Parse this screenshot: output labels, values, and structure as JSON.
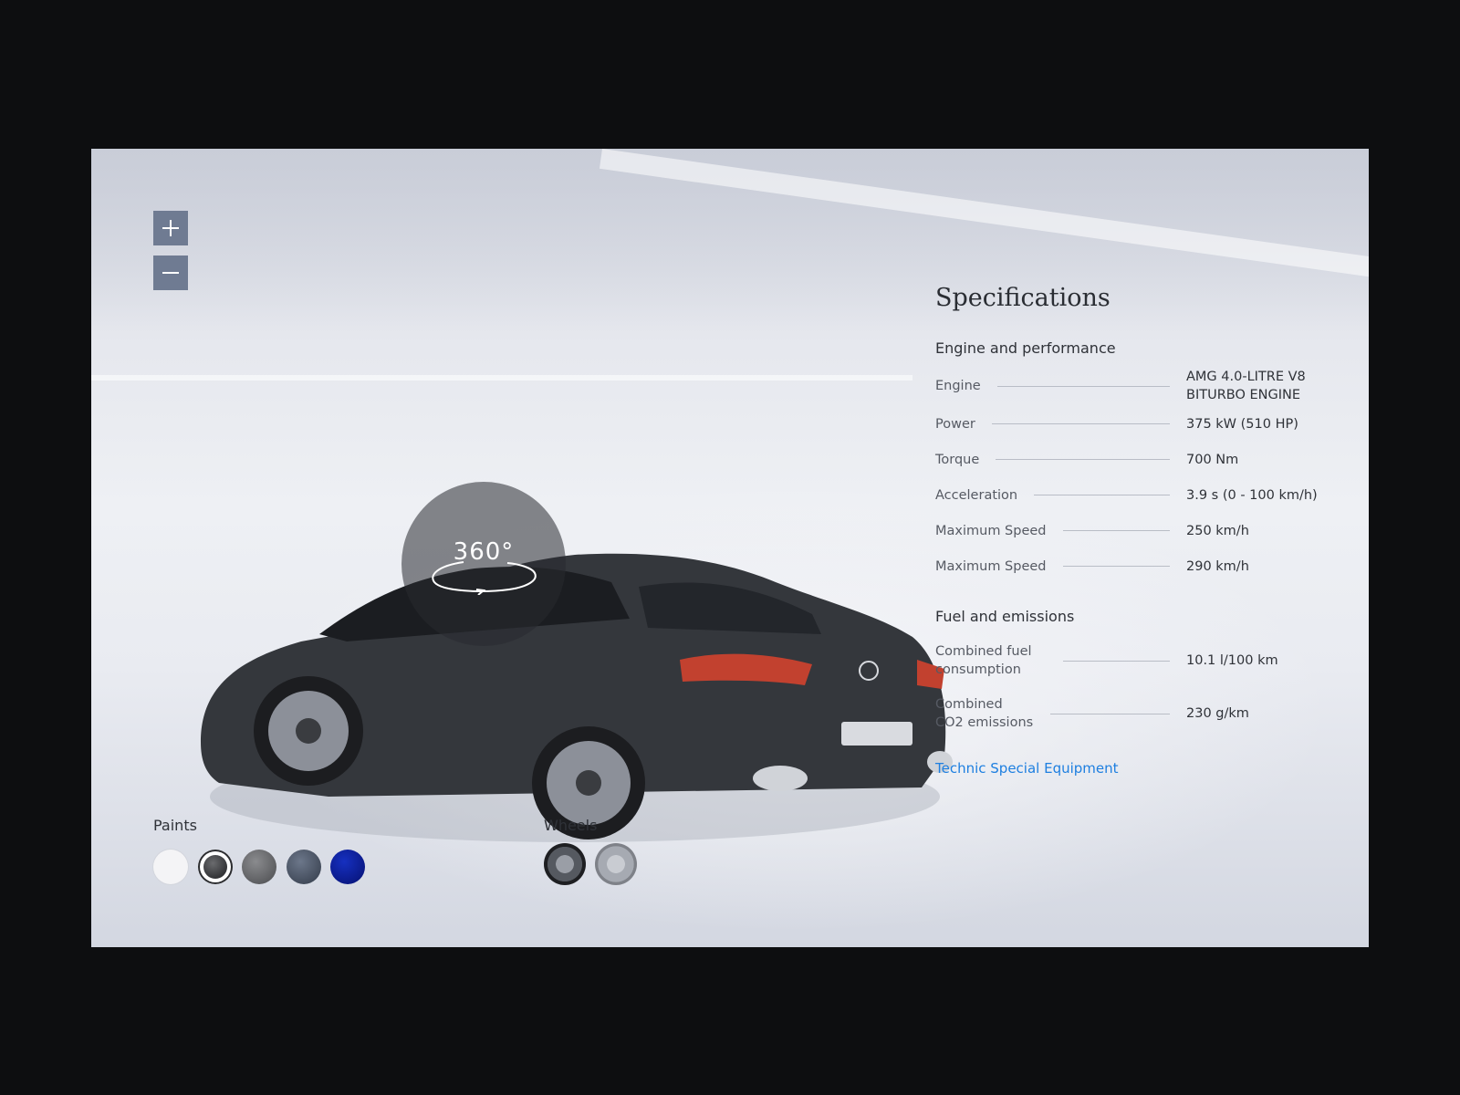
{
  "zoom": {
    "in_icon": "plus-icon",
    "out_icon": "minus-icon"
  },
  "viewer": {
    "rotate_label": "360°"
  },
  "specs": {
    "title": "Specifications",
    "engine_section": "Engine and performance",
    "engine_rows": [
      {
        "label": "Engine",
        "value": "AMG 4.0-LITRE V8 BITURBO ENGINE"
      },
      {
        "label": "Power",
        "value": "375 kW (510 HP)"
      },
      {
        "label": "Torque",
        "value": "700 Nm"
      },
      {
        "label": "Acceleration",
        "value": "3.9 s (0 - 100 km/h)"
      },
      {
        "label": "Maximum Speed",
        "value": "250 km/h"
      },
      {
        "label": "Maximum Speed",
        "value": "290 km/h"
      }
    ],
    "fuel_section": "Fuel and emissions",
    "fuel_rows": [
      {
        "label": "Combined fuel consumption",
        "value": "10.1 l/100 km"
      },
      {
        "label": "Combined CO2 emissions",
        "value": "230 g/km"
      }
    ],
    "link": "Technic Special Equipment"
  },
  "paints": {
    "label": "Paints",
    "swatches": [
      {
        "color": "#f4f4f6"
      },
      {
        "color": "#2b2c2f",
        "selected": true
      },
      {
        "color": "#6a6b6e"
      },
      {
        "color": "#4c5566"
      },
      {
        "color": "#0a1a8c"
      }
    ]
  },
  "wheels": {
    "label": "Wheels"
  },
  "colors": {
    "link": "#1e7fe0",
    "zoom_button": "#6f7b92",
    "car_body": "#34373c"
  }
}
